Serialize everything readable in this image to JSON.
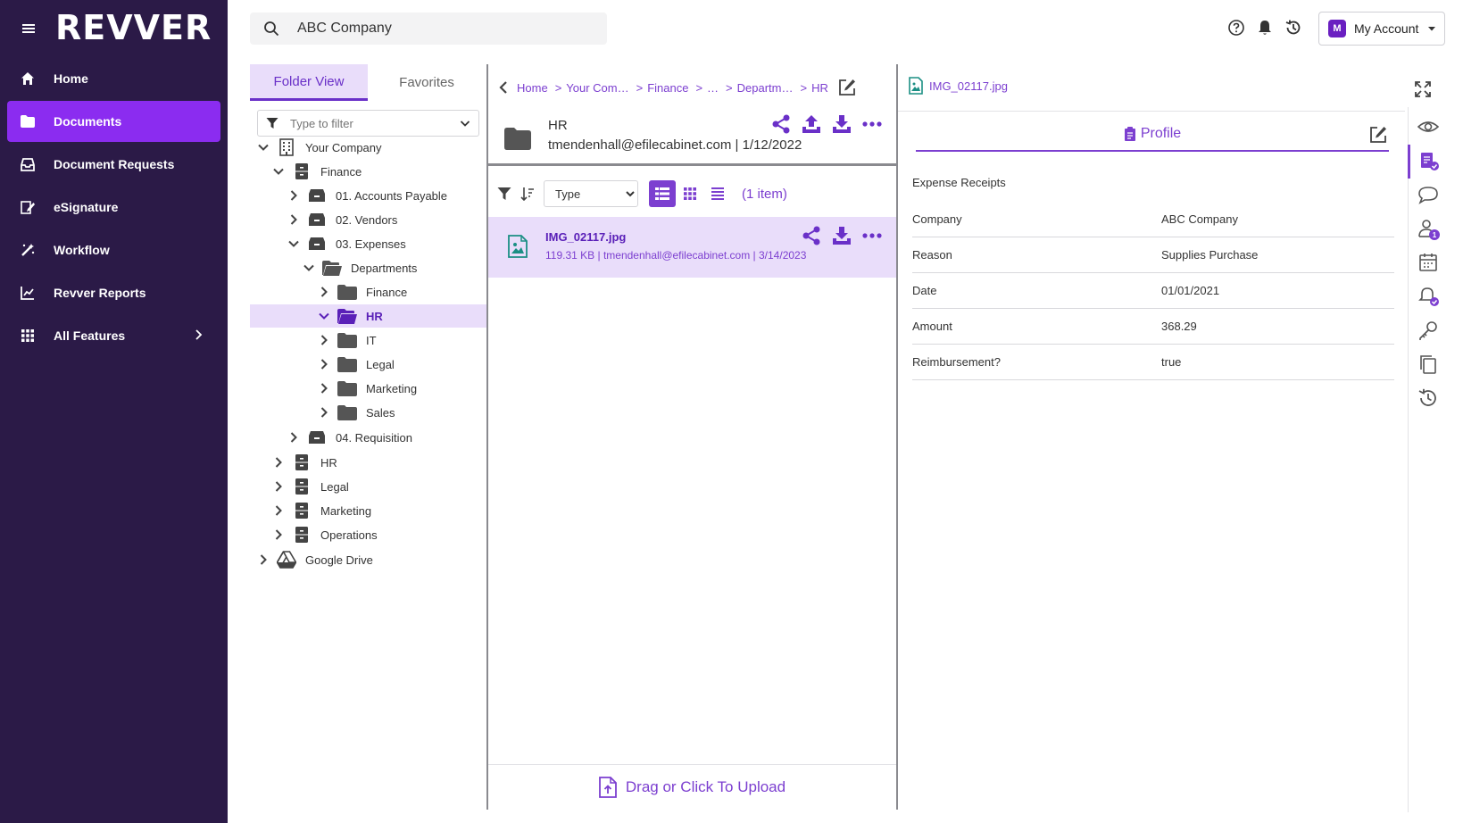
{
  "app": {
    "logo_text": "REVVER"
  },
  "nav": {
    "items": [
      {
        "label": "Home"
      },
      {
        "label": "Documents"
      },
      {
        "label": "Document Requests"
      },
      {
        "label": "eSignature"
      },
      {
        "label": "Workflow"
      },
      {
        "label": "Revver Reports"
      },
      {
        "label": "All Features"
      }
    ]
  },
  "search": {
    "value": "ABC Company"
  },
  "account": {
    "initial": "M",
    "label": "My Account"
  },
  "tree_panel": {
    "tabs": [
      {
        "label": "Folder View"
      },
      {
        "label": "Favorites"
      }
    ],
    "filter_placeholder": "Type to filter",
    "nodes": [
      {
        "label": "Your Company"
      },
      {
        "label": "Finance"
      },
      {
        "label": "01. Accounts Payable"
      },
      {
        "label": "02. Vendors"
      },
      {
        "label": "03. Expenses"
      },
      {
        "label": "Departments"
      },
      {
        "label": "Finance"
      },
      {
        "label": "HR"
      },
      {
        "label": "IT"
      },
      {
        "label": "Legal"
      },
      {
        "label": "Marketing"
      },
      {
        "label": "Sales"
      },
      {
        "label": "04. Requisition"
      },
      {
        "label": "HR"
      },
      {
        "label": "Legal"
      },
      {
        "label": "Marketing"
      },
      {
        "label": "Operations"
      },
      {
        "label": "Google Drive"
      }
    ]
  },
  "middle": {
    "breadcrumbs": [
      "Home",
      "Your Com…",
      "Finance",
      "…",
      "Departm…",
      "HR"
    ],
    "folder": {
      "name": "HR",
      "meta": "tmendenhall@efilecabinet.com | 1/12/2022"
    },
    "type_select": "Type",
    "item_count": "(1 item)",
    "file": {
      "name": "IMG_02117.jpg",
      "meta": "119.31 KB | tmendenhall@efilecabinet.com | 3/14/2023"
    },
    "upload_label": "Drag or Click To Upload"
  },
  "right": {
    "file_name": "IMG_02117.jpg",
    "profile_tab": "Profile",
    "doc_type": "Expense Receipts",
    "properties": [
      {
        "key": "Company",
        "value": "ABC Company"
      },
      {
        "key": "Reason",
        "value": "Supplies Purchase"
      },
      {
        "key": "Date",
        "value": "01/01/2021"
      },
      {
        "key": "Amount",
        "value": "368.29"
      },
      {
        "key": "Reimbursement?",
        "value": "true"
      }
    ],
    "rail_badge_count": "1"
  },
  "colors": {
    "nav_bg": "#2b1a47",
    "nav_active": "#8b2cf0",
    "accent": "#7c3fd0",
    "selected_bg": "#e9ddfa"
  }
}
